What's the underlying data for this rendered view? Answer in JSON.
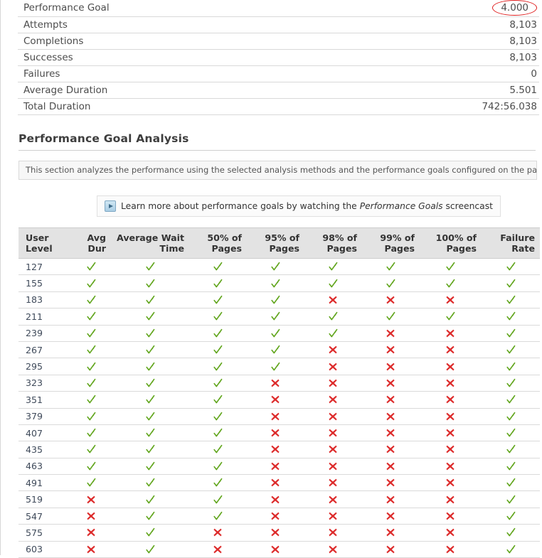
{
  "summary": {
    "rows": [
      {
        "label": "Performance Goal",
        "value": "4.000",
        "highlighted": true
      },
      {
        "label": "Attempts",
        "value": "8,103",
        "highlighted": false
      },
      {
        "label": "Completions",
        "value": "8,103",
        "highlighted": false
      },
      {
        "label": "Successes",
        "value": "8,103",
        "highlighted": false
      },
      {
        "label": "Failures",
        "value": "0",
        "highlighted": false
      },
      {
        "label": "Average Duration",
        "value": "5.501",
        "highlighted": false
      },
      {
        "label": "Total Duration",
        "value": "742:56.038",
        "highlighted": false
      }
    ],
    "highlight_color": "#e01b1b"
  },
  "section": {
    "heading": "Performance Goal Analysis",
    "description": "This section analyzes the performance using the selected analysis methods and the performance goals configured on the page."
  },
  "screencast": {
    "icon": "play-icon",
    "text_before": "Learn more about performance goals by watching the",
    "emphasis": "Performance Goals",
    "text_after": "screencast"
  },
  "analysis_table": {
    "columns": [
      "User Level",
      "Avg Dur",
      "Average Wait Time",
      "50% of Pages",
      "95% of Pages",
      "98% of Pages",
      "99% of Pages",
      "100% of Pages",
      "Failure Rate"
    ],
    "pass_symbol": "check-icon",
    "fail_symbol": "cross-icon",
    "pass_color": "#62a61e",
    "fail_color": "#dd2c2c",
    "rows": [
      {
        "level": "127",
        "marks": [
          "pass",
          "pass",
          "pass",
          "pass",
          "pass",
          "pass",
          "pass",
          "pass"
        ]
      },
      {
        "level": "155",
        "marks": [
          "pass",
          "pass",
          "pass",
          "pass",
          "pass",
          "pass",
          "pass",
          "pass"
        ]
      },
      {
        "level": "183",
        "marks": [
          "pass",
          "pass",
          "pass",
          "pass",
          "fail",
          "fail",
          "fail",
          "pass"
        ]
      },
      {
        "level": "211",
        "marks": [
          "pass",
          "pass",
          "pass",
          "pass",
          "pass",
          "pass",
          "pass",
          "pass"
        ]
      },
      {
        "level": "239",
        "marks": [
          "pass",
          "pass",
          "pass",
          "pass",
          "pass",
          "fail",
          "fail",
          "pass"
        ]
      },
      {
        "level": "267",
        "marks": [
          "pass",
          "pass",
          "pass",
          "pass",
          "fail",
          "fail",
          "fail",
          "pass"
        ]
      },
      {
        "level": "295",
        "marks": [
          "pass",
          "pass",
          "pass",
          "pass",
          "fail",
          "fail",
          "fail",
          "pass"
        ]
      },
      {
        "level": "323",
        "marks": [
          "pass",
          "pass",
          "pass",
          "fail",
          "fail",
          "fail",
          "fail",
          "pass"
        ]
      },
      {
        "level": "351",
        "marks": [
          "pass",
          "pass",
          "pass",
          "fail",
          "fail",
          "fail",
          "fail",
          "pass"
        ]
      },
      {
        "level": "379",
        "marks": [
          "pass",
          "pass",
          "pass",
          "fail",
          "fail",
          "fail",
          "fail",
          "pass"
        ]
      },
      {
        "level": "407",
        "marks": [
          "pass",
          "pass",
          "pass",
          "fail",
          "fail",
          "fail",
          "fail",
          "pass"
        ]
      },
      {
        "level": "435",
        "marks": [
          "pass",
          "pass",
          "pass",
          "fail",
          "fail",
          "fail",
          "fail",
          "pass"
        ]
      },
      {
        "level": "463",
        "marks": [
          "pass",
          "pass",
          "pass",
          "fail",
          "fail",
          "fail",
          "fail",
          "pass"
        ]
      },
      {
        "level": "491",
        "marks": [
          "pass",
          "pass",
          "pass",
          "fail",
          "fail",
          "fail",
          "fail",
          "pass"
        ]
      },
      {
        "level": "519",
        "marks": [
          "fail",
          "pass",
          "pass",
          "fail",
          "fail",
          "fail",
          "fail",
          "pass"
        ]
      },
      {
        "level": "547",
        "marks": [
          "fail",
          "pass",
          "pass",
          "fail",
          "fail",
          "fail",
          "fail",
          "pass"
        ]
      },
      {
        "level": "575",
        "marks": [
          "fail",
          "pass",
          "fail",
          "fail",
          "fail",
          "fail",
          "fail",
          "pass"
        ]
      },
      {
        "level": "603",
        "marks": [
          "fail",
          "pass",
          "fail",
          "fail",
          "fail",
          "fail",
          "fail",
          "pass"
        ]
      }
    ]
  }
}
